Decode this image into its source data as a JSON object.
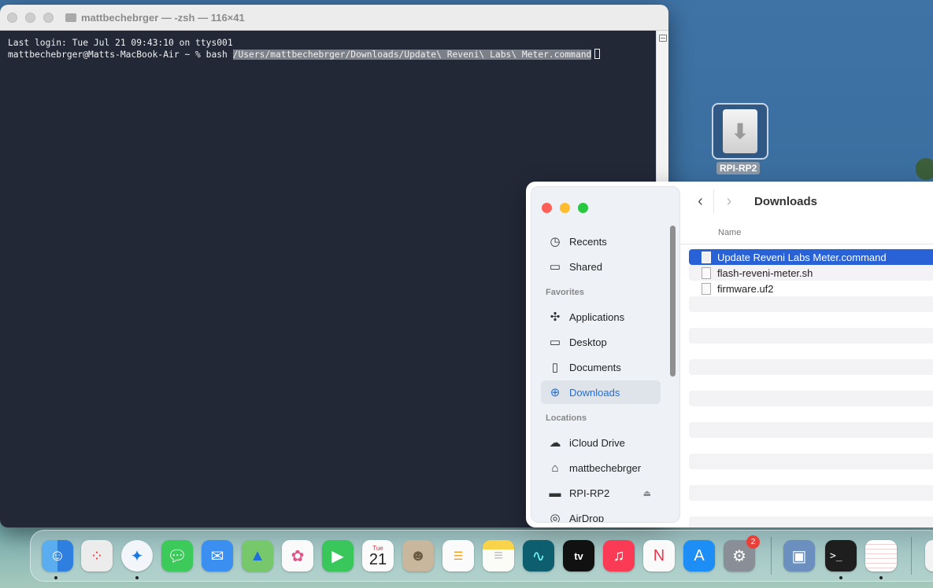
{
  "terminal": {
    "title": "mattbechebrger — -zsh — 116×41",
    "line1": "Last login: Tue Jul 21 09:43:10 on ttys001",
    "prompt": "mattbechebrger@Matts-MacBook-Air ~ % bash ",
    "selected_path": "/Users/mattbechebrger/Downloads/Update\\ Reveni\\ Labs\\ Meter.command"
  },
  "desktop": {
    "drive_label": "RPI-RP2"
  },
  "finder": {
    "title": "Downloads",
    "column_name": "Name",
    "sidebar": {
      "recents": "Recents",
      "shared": "Shared",
      "favorites_heading": "Favorites",
      "applications": "Applications",
      "desktop": "Desktop",
      "documents": "Documents",
      "downloads": "Downloads",
      "locations_heading": "Locations",
      "icloud": "iCloud Drive",
      "home": "mattbechebrger",
      "drive": "RPI-RP2",
      "airdrop": "AirDrop"
    },
    "files": [
      {
        "name": "Update Reveni Labs Meter.command"
      },
      {
        "name": "flash-reveni-meter.sh"
      },
      {
        "name": "firmware.uf2"
      }
    ]
  },
  "dock": {
    "calendar_month": "Tue",
    "calendar_day": "21",
    "tv_label": "tv",
    "settings_badge": "2",
    "terminal_glyph": ">_"
  }
}
